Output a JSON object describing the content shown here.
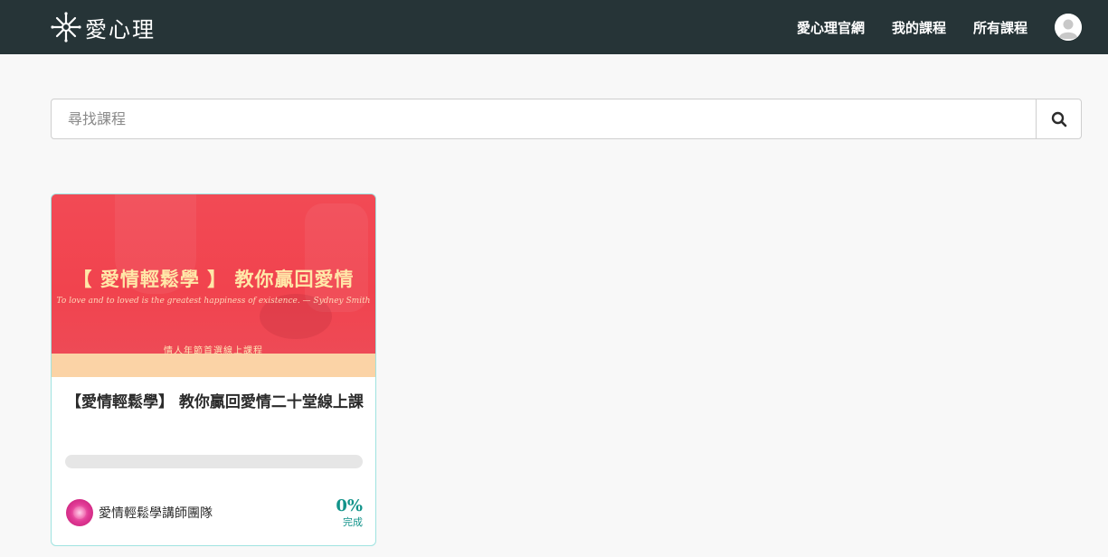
{
  "navbar": {
    "brand_name": "愛心理",
    "links": [
      {
        "label": "愛心理官網"
      },
      {
        "label": "我的課程"
      },
      {
        "label": "所有課程"
      }
    ]
  },
  "search": {
    "placeholder": "尋找課程"
  },
  "courses": [
    {
      "thumbnail": {
        "title": "【 愛情輕鬆學 】 教你贏回愛情",
        "quote": "To love and to loved is the greatest happiness of existence. — Sydney Smith",
        "subtitle": "情人年節首選線上課程"
      },
      "title": "【愛情輕鬆學】 教你贏回愛情二十堂線上課",
      "progress_percent": 0,
      "instructor": "愛情輕鬆學講師團隊",
      "percent_text": "0%",
      "percent_label": "完成"
    }
  ],
  "colors": {
    "navbar_bg": "#263437",
    "accent": "#12938a",
    "card_border": "#9fe3e0"
  }
}
